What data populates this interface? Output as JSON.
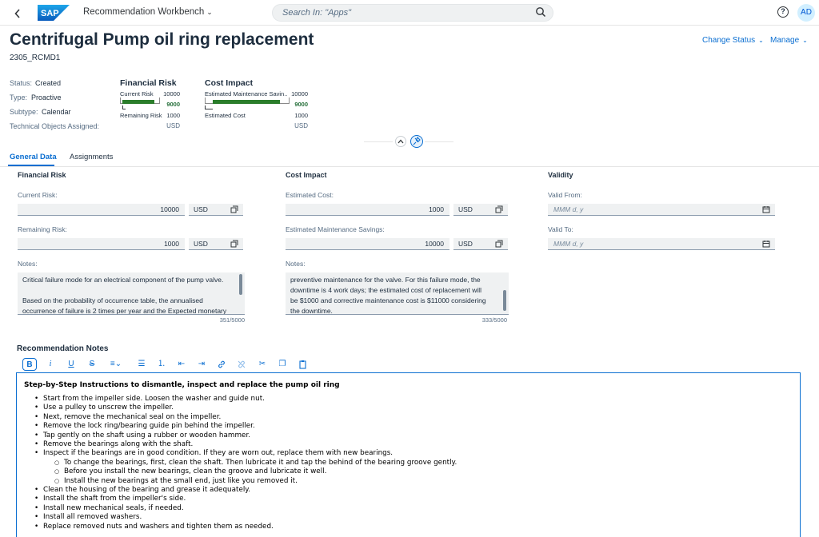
{
  "shell": {
    "app_title": "Recommendation Workbench",
    "search_placeholder": "Search In: \"Apps\"",
    "avatar": "AD",
    "help": "?"
  },
  "header": {
    "title": "Centrifugal Pump oil ring replacement",
    "id": "2305_RCMD1",
    "actions": [
      "Change Status",
      "Manage"
    ],
    "attributes": [
      {
        "label": "Status:",
        "value": "Created"
      },
      {
        "label": "Type:",
        "value": "Proactive"
      },
      {
        "label": "Subtype:",
        "value": "Calendar"
      },
      {
        "label": "Technical Objects Assigned:",
        "value": ""
      }
    ]
  },
  "kpis": {
    "financial": {
      "title": "Financial Risk",
      "primary_label": "Current Risk",
      "primary_max": "10000",
      "primary_value": "9000",
      "primary_fraction": 0.9,
      "secondary_label": "Remaining Risk",
      "secondary_value": "1000",
      "currency": "USD"
    },
    "cost": {
      "title": "Cost Impact",
      "primary_label": "Estimated Maintenance Savin...",
      "primary_max": "10000",
      "primary_value": "9000",
      "primary_fraction": 0.9,
      "secondary_label": "Estimated Cost",
      "secondary_value": "1000",
      "currency": "USD"
    }
  },
  "tabs": [
    "General Data",
    "Assignments"
  ],
  "form": {
    "financial": {
      "title": "Financial Risk",
      "current_label": "Current Risk:",
      "current_value": "10000",
      "current_currency": "USD",
      "remaining_label": "Remaining Risk:",
      "remaining_value": "1000",
      "remaining_currency": "USD",
      "notes_label": "Notes:",
      "notes_lines": [
        "Critical failure mode for an electrical component of the pump valve.",
        "",
        "Based on the probability of occurrence table, the annualised",
        "occurrence of failure is 2 times per year and the Expected monetary"
      ],
      "counter": "351/5000"
    },
    "cost": {
      "title": "Cost Impact",
      "est_cost_label": "Estimated Cost:",
      "est_cost_value": "1000",
      "est_cost_currency": "USD",
      "savings_label": "Estimated Maintenance Savings:",
      "savings_value": "10000",
      "savings_currency": "USD",
      "notes_label": "Notes:",
      "notes_lines": [
        "preventive maintenance for the valve. For this failure mode, the",
        "downtime is 4 work days; the estimated cost of replacement will",
        "be $1000 and corrective maintenance cost is $11000 considering",
        "the downtime."
      ],
      "counter": "333/5000"
    },
    "validity": {
      "title": "Validity",
      "from_label": "Valid From:",
      "from_placeholder": "MMM d, y",
      "to_label": "Valid To:",
      "to_placeholder": "MMM d, y"
    }
  },
  "rte": {
    "title": "Recommendation Notes",
    "heading": "Step-by-Step Instructions to dismantle, inspect and replace the pump oil ring",
    "items": [
      {
        "text": "Start from the impeller side. Loosen the washer and guide nut.",
        "level": 1
      },
      {
        "text": "Use a pulley to unscrew the impeller.",
        "level": 1
      },
      {
        "text": "Next, remove the mechanical seal on the impeller.",
        "level": 1
      },
      {
        "text": "Remove the lock ring/bearing guide pin behind the impeller.",
        "level": 1
      },
      {
        "text": "Tap gently on the shaft using a rubber or wooden hammer.",
        "level": 1
      },
      {
        "text": "Remove the bearings along with the shaft.",
        "level": 1
      },
      {
        "text": "Inspect if the bearings are in good condition. If they are worn out, replace them with new bearings.",
        "level": 1
      },
      {
        "text": "To change the bearings, first, clean the shaft. Then lubricate it and tap the behind of the bearing groove gently.",
        "level": 2
      },
      {
        "text": "Before you install the new bearings, clean the groove and lubricate it well.",
        "level": 2
      },
      {
        "text": "Install the new bearings at the small end, just like you removed it.",
        "level": 2
      },
      {
        "text": "Clean the housing of the bearing and grease it adequately.",
        "level": 1
      },
      {
        "text": "Install the shaft from the impeller's side.",
        "level": 1
      },
      {
        "text": "Install new mechanical seals, if needed.",
        "level": 1
      },
      {
        "text": "Install all removed washers.",
        "level": 1
      },
      {
        "text": "Replace removed nuts and washers and tighten them as needed.",
        "level": 1
      }
    ],
    "toolbar": [
      "bold",
      "italic",
      "underline",
      "strikethrough",
      "text-align",
      "unordered-list",
      "ordered-list",
      "outdent",
      "indent",
      "link",
      "unlink",
      "cut",
      "copy",
      "paste"
    ]
  },
  "colors": {
    "brand": "#0a6ed1",
    "positive": "#2b7d2b",
    "field_bg": "#eff1f2"
  }
}
